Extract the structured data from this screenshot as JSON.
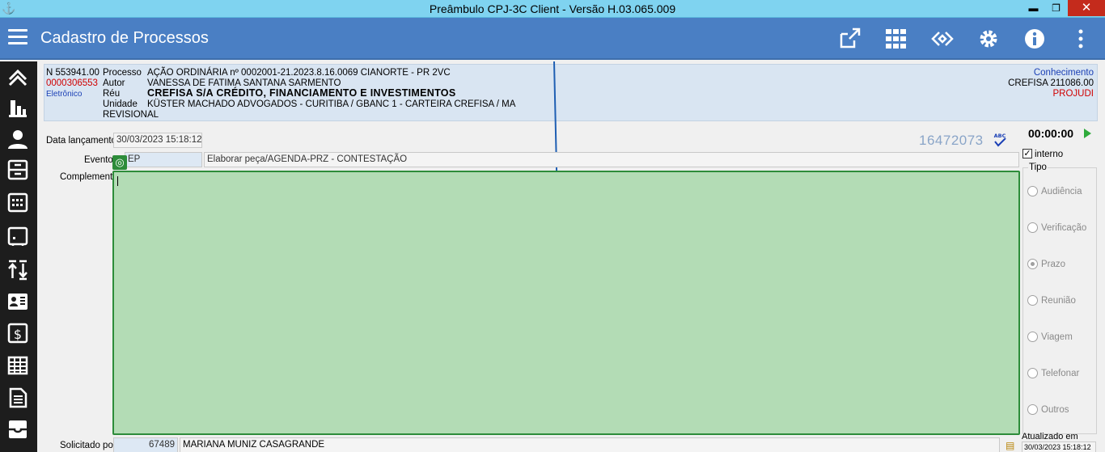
{
  "window": {
    "title": "Preâmbulo CPJ-3C Client - Versão H.03.065.009",
    "min_label": "▬",
    "max_label": "❐",
    "close_label": "✕"
  },
  "appbar": {
    "title": "Cadastro de Processos",
    "tools": [
      "external-link-icon",
      "grid-apps-icon",
      "code-diamond-icon",
      "gear-icon",
      "info-icon",
      "more-vertical-icon"
    ]
  },
  "sidebar": {
    "items": [
      "collapse-up-icon",
      "bar-chart-icon",
      "person-icon",
      "archive-icon",
      "calendar-icon",
      "wallet-icon",
      "sort-arrows-icon",
      "id-card-icon",
      "dollar-icon",
      "table-icon",
      "document-icon",
      "inbox-icon"
    ]
  },
  "process": {
    "number_line": "N 553941.00",
    "processo_label": "Processo",
    "processo_value": "AÇÃO ORDINÁRIA   nº 0002001-21.2023.8.16.0069   CIANORTE - PR   2VC",
    "code": "0000306553",
    "autor_label": "Autor",
    "autor_value": "VANESSA DE FATIMA SANTANA SARMENTO",
    "eletronico": "Eletrônico",
    "reu_label": "Réu",
    "reu_value": "CREFISA S/A CRÉDITO, FINANCIAMENTO E INVESTIMENTOS",
    "unidade_label": "Unidade",
    "unidade_value": "KÜSTER MACHADO ADVOGADOS - CURITIBA / GBANC 1  - CARTEIRA CREFISA / MA",
    "revisional": "REVISIONAL",
    "conhecimento": "Conhecimento",
    "crefisa": "CREFISA 211086.00",
    "projudi": "PROJUDI"
  },
  "form": {
    "data_lancamento_label": "Data lançamento",
    "data_lancamento_value": "30/03/2023 15:18:12",
    "evento_label": "Evento",
    "evento_code": "EP",
    "evento_desc": "Elaborar peça/AGENDA-PRZ - CONTESTAÇÃO",
    "complemento_label": "Complemento",
    "record_number": "16472073",
    "spell_label": "ABC",
    "timer": "00:00:00",
    "interno_label": "interno",
    "interno_checked": true,
    "tipo_label": "Tipo",
    "tipo_options": [
      "Audiência",
      "Verificação",
      "Prazo",
      "Reunião",
      "Viagem",
      "Telefonar",
      "Outros"
    ],
    "tipo_selected": "Prazo",
    "solicitado_label": "Solicitado por",
    "solicitado_code": "67489",
    "solicitado_name": "MARIANA MUNIZ CASAGRANDE",
    "atualizado_label": "Atualizado em",
    "atualizado_value": "30/03/2023 15:18:12"
  },
  "colors": {
    "appbar": "#4a7fc4",
    "titlebar": "#7fd3f0",
    "complement_bg": "#b3dcb5",
    "complement_border": "#2d8c3a"
  }
}
